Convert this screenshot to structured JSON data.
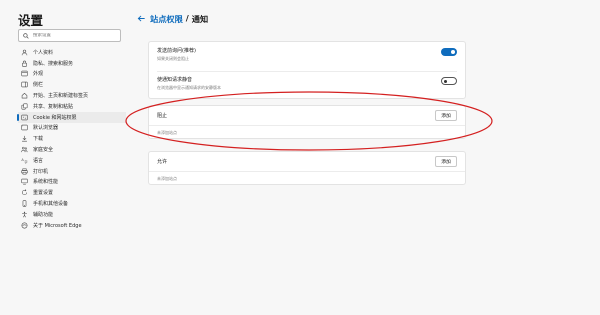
{
  "sidebar": {
    "title": "设置",
    "search_placeholder": "搜索设置",
    "items": [
      {
        "label": "个人资料",
        "icon": "person-icon"
      },
      {
        "label": "隐私、搜索和服务",
        "icon": "lock-icon"
      },
      {
        "label": "外观",
        "icon": "appearance-icon"
      },
      {
        "label": "侧栏",
        "icon": "sidebar-icon"
      },
      {
        "label": "开始、主页和新建标签页",
        "icon": "home-icon"
      },
      {
        "label": "共享、复制和粘贴",
        "icon": "share-icon"
      },
      {
        "label": "Cookie 和网站权限",
        "icon": "cookie-icon",
        "active": true
      },
      {
        "label": "默认浏览器",
        "icon": "browser-icon"
      },
      {
        "label": "下载",
        "icon": "download-icon"
      },
      {
        "label": "家庭安全",
        "icon": "family-icon"
      },
      {
        "label": "语言",
        "icon": "language-icon"
      },
      {
        "label": "打印机",
        "icon": "printer-icon"
      },
      {
        "label": "系统和性能",
        "icon": "system-icon"
      },
      {
        "label": "重置设置",
        "icon": "reset-icon"
      },
      {
        "label": "手机和其他设备",
        "icon": "phone-icon"
      },
      {
        "label": "辅助功能",
        "icon": "accessibility-icon"
      },
      {
        "label": "关于 Microsoft Edge",
        "icon": "edge-icon"
      }
    ]
  },
  "header": {
    "parent": "站点权限",
    "separator": "/",
    "current": "通知"
  },
  "toggles": {
    "ask_before_send": {
      "title": "发送前询问(推荐)",
      "desc": "如果关闭则会阻止",
      "state": "on"
    },
    "quiet_requests": {
      "title": "使通知请求静音",
      "desc": "在浏览器中显示通知请求的安静版本",
      "state": "off"
    }
  },
  "block": {
    "title": "阻止",
    "add_label": "添加",
    "empty_text": "未添加站点"
  },
  "allow": {
    "title": "允许",
    "add_label": "添加",
    "empty_text": "未添加站点"
  },
  "colors": {
    "accent": "#0f6cbd",
    "annotation": "#d42020"
  }
}
